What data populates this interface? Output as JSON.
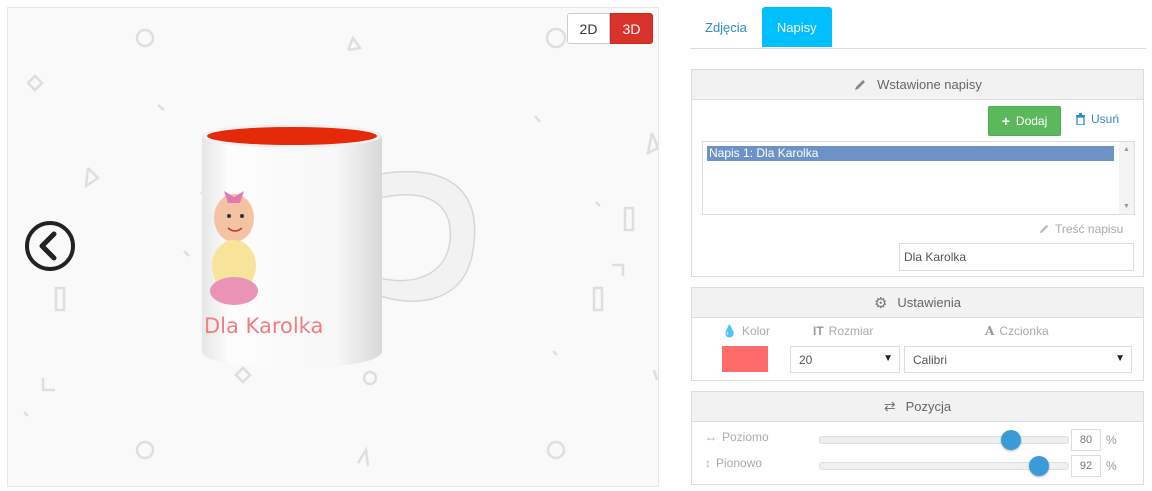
{
  "preview": {
    "btn_2d": "2D",
    "btn_3d": "3D",
    "mug_text": "Dla Karolka",
    "mug_inner_color": "#e52a0a"
  },
  "tabs": [
    {
      "label": "Zdjęcia",
      "active": false
    },
    {
      "label": "Napisy",
      "active": true
    }
  ],
  "texts_panel": {
    "title": "Wstawione napisy",
    "add_label": "Dodaj",
    "remove_label": "Usuń",
    "items": [
      "Napis 1: Dla Karolka"
    ],
    "content_label": "Treść napisu",
    "content_value": "Dla Karolka"
  },
  "settings_panel": {
    "title": "Ustawienia",
    "color_label": "Kolor",
    "size_label": "Rozmiar",
    "font_label": "Czcionka",
    "color_value": "#ff6b6b",
    "size_value": "20",
    "font_value": "Calibri"
  },
  "position_panel": {
    "title": "Pozycja",
    "horizontal_label": "Poziomo",
    "vertical_label": "Pionowo",
    "horizontal_value": "80",
    "vertical_value": "92",
    "unit": "%"
  }
}
